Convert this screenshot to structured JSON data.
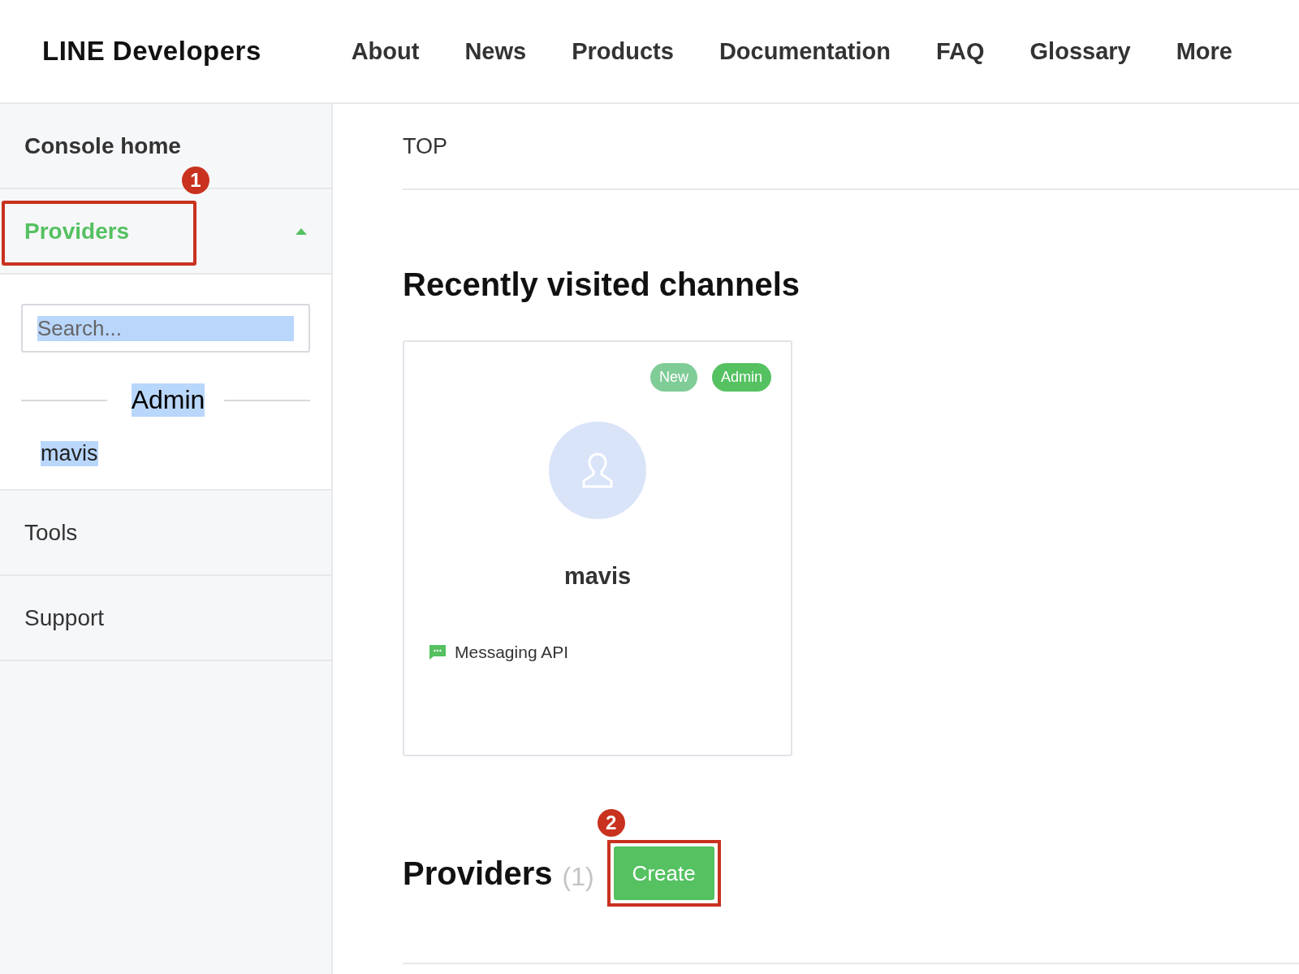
{
  "header": {
    "logo": "LINE Developers",
    "nav": [
      {
        "label": "About"
      },
      {
        "label": "News"
      },
      {
        "label": "Products"
      },
      {
        "label": "Documentation"
      },
      {
        "label": "FAQ"
      },
      {
        "label": "Glossary"
      },
      {
        "label": "More"
      }
    ]
  },
  "sidebar": {
    "console_home": {
      "label": "Console home"
    },
    "providers": {
      "label": "Providers",
      "selected": true,
      "expanded": true,
      "callout": "1",
      "search": {
        "placeholder": "Search...",
        "text_selected": true
      },
      "group": {
        "label": "Admin",
        "text_selected": true
      },
      "items": [
        {
          "label": "mavis",
          "text_selected": true
        }
      ]
    },
    "links": [
      {
        "label": "Tools"
      },
      {
        "label": "Support"
      }
    ]
  },
  "main": {
    "breadcrumb": "TOP",
    "recent_title": "Recently visited channels",
    "channels": [
      {
        "name": "mavis",
        "tags": [
          {
            "label": "New",
            "color": "#80cc97"
          },
          {
            "label": "Admin",
            "color": "#55c161"
          }
        ],
        "product": "Messaging API"
      }
    ],
    "providers_title": "Providers",
    "providers_count": "(1)",
    "create_button": {
      "label": "Create",
      "callout": "2"
    }
  }
}
